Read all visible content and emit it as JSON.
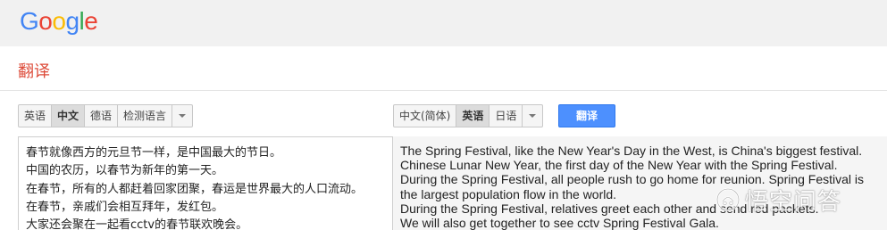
{
  "header": {
    "logo": {
      "letters": [
        "G",
        "o",
        "o",
        "g",
        "l",
        "e"
      ],
      "colors": [
        "#4285f4",
        "#ea4335",
        "#fbbc05",
        "#4285f4",
        "#34a853",
        "#ea4335"
      ]
    }
  },
  "page": {
    "title": "翻译"
  },
  "source_langs": {
    "items": [
      "英语",
      "中文",
      "德语",
      "检测语言"
    ],
    "active_index": 1
  },
  "target_langs": {
    "items": [
      "中文(简体)",
      "英语",
      "日语"
    ],
    "active_index": 1
  },
  "translate_button": {
    "label": "翻译",
    "color": "#4d90fe"
  },
  "source_text": {
    "lines": [
      "春节就像西方的元旦节一样，是中国最大的节日。",
      "中国的农历，以春节为新年的第一天。",
      "在春节，所有的人都赶着回家团聚，春运是世界最大的人口流动。",
      "在春节，亲戚们会相互拜年，发红包。",
      "大家还会聚在一起看cctv的春节联欢晚会。"
    ]
  },
  "target_text": {
    "lines": [
      "The Spring Festival, like the New Year's Day in the West, is China's biggest festival.",
      "Chinese Lunar New Year, the first day of the New Year with the Spring Festival.",
      "During the Spring Festival, all people rush to go home for reunion. Spring Festival is",
      "the largest population flow in the world.",
      "During the Spring Festival, relatives greet each other and send red packets.",
      "We will also get together to see cctv Spring Festival Gala."
    ]
  },
  "watermark": {
    "text": "悟空问答",
    "icon": "wukong-logo-icon"
  }
}
